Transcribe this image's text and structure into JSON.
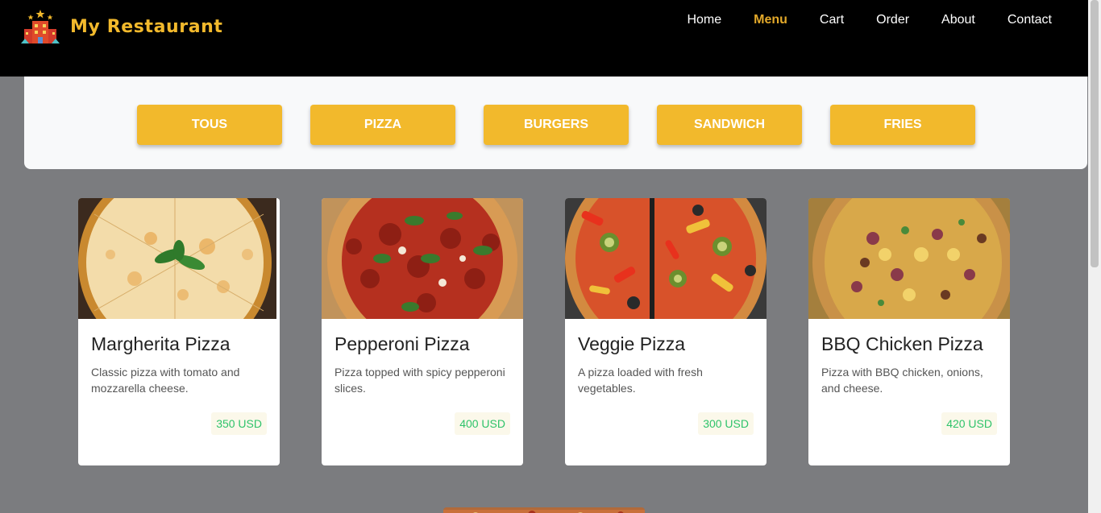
{
  "brand": {
    "name": "My Restaurant"
  },
  "nav": [
    {
      "label": "Home",
      "active": false
    },
    {
      "label": "Menu",
      "active": true
    },
    {
      "label": "Cart",
      "active": false
    },
    {
      "label": "Order",
      "active": false
    },
    {
      "label": "About",
      "active": false
    },
    {
      "label": "Contact",
      "active": false
    }
  ],
  "filters": [
    "TOUS",
    "PIZZA",
    "BURGERS",
    "SANDWICH",
    "FRIES"
  ],
  "items": [
    {
      "title": "Margherita Pizza",
      "desc": "Classic pizza with tomato and mozzarella cheese.",
      "price": "350 USD"
    },
    {
      "title": "Pepperoni Pizza",
      "desc": "Pizza topped with spicy pepperoni slices.",
      "price": "400 USD"
    },
    {
      "title": "Veggie Pizza",
      "desc": "A pizza loaded with fresh vegetables.",
      "price": "300 USD"
    },
    {
      "title": "BBQ Chicken Pizza",
      "desc": "Pizza with BBQ chicken, onions, and cheese.",
      "price": "420 USD"
    }
  ],
  "colors": {
    "accent": "#f2b92c",
    "price": "#2ec36a",
    "navbar": "#000000",
    "background": "#7b7c7f"
  }
}
